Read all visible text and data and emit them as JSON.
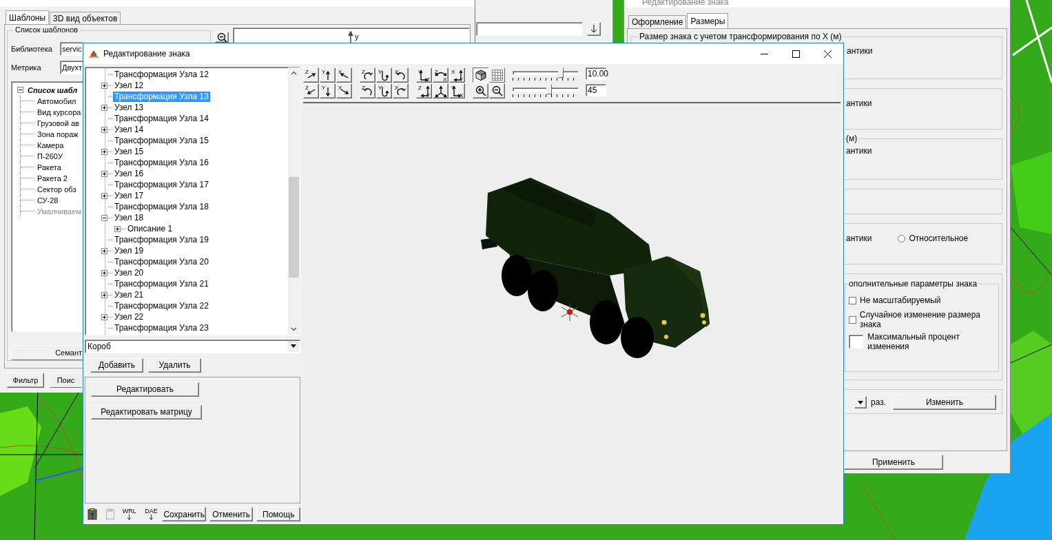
{
  "left_window": {
    "tabs": [
      {
        "label": "Шаблоны",
        "selected": true
      },
      {
        "label": "3D вид объектов",
        "selected": false
      }
    ],
    "group_title": "Список шаблонов",
    "library": {
      "label": "Библиотека",
      "value": "servic"
    },
    "metric": {
      "label": "Метрика",
      "value": "Двухт"
    },
    "templates": {
      "label": "Список шабл",
      "expanded": true,
      "children": [
        {
          "label": "Автомобил",
          "disabled": false
        },
        {
          "label": "Вид курсора",
          "disabled": false
        },
        {
          "label": "Грузовой ав",
          "disabled": false
        },
        {
          "label": "Зона пораж",
          "disabled": false
        },
        {
          "label": "Камера",
          "disabled": false
        },
        {
          "label": "П-260У",
          "disabled": false
        },
        {
          "label": "Ракета",
          "disabled": false
        },
        {
          "label": "Ракета 2",
          "disabled": false
        },
        {
          "label": "Сектор обз",
          "disabled": false
        },
        {
          "label": "СУ-28",
          "disabled": false
        },
        {
          "label": "Умалчиваем",
          "disabled": true
        }
      ]
    },
    "semantics_button": "Семант",
    "buttons": [
      "Фильтр",
      "Поис"
    ],
    "preview_axis": "y"
  },
  "right_window": {
    "title": "Редактирование знака",
    "tabs": [
      {
        "label": "Оформление",
        "selected": false
      },
      {
        "label": "Размеры",
        "selected": true
      }
    ],
    "groups": [
      {
        "kind": "text",
        "title": "Размер знака с учетом трансформирования по X (м)",
        "text": "антики"
      },
      {
        "kind": "text",
        "text": "антики"
      },
      {
        "kind": "text",
        "title_tail": "(м)",
        "text": "антики"
      },
      {
        "kind": "empty"
      },
      {
        "kind": "radio",
        "text": "антики",
        "radio": {
          "label": "Относительное",
          "selected": false
        }
      },
      {
        "kind": "options",
        "title_tail": "ополнительные параметры знака",
        "options": [
          {
            "label": "Не масштабируемый",
            "checked": false
          },
          {
            "label": "Случайное изменение размера знака",
            "checked": false
          }
        ],
        "percent_label": "Максимальный процент изменения"
      },
      {
        "kind": "scale",
        "unit": "раз.",
        "button": "Изменить"
      }
    ],
    "apply_button": "Применить"
  },
  "editor": {
    "title": "Редактирование знака",
    "tree": [
      {
        "label": "Трансформация Узла 12",
        "selected": false
      },
      {
        "label": "Узел 12",
        "expanded": false,
        "selected": false
      },
      {
        "label": "Трансформация Узла 13",
        "selected": true
      },
      {
        "label": "Узел 13",
        "expanded": false,
        "selected": false
      },
      {
        "label": "Трансформация Узла 14",
        "selected": false
      },
      {
        "label": "Узел 14",
        "expanded": false,
        "selected": false
      },
      {
        "label": "Трансформация Узла 15",
        "selected": false
      },
      {
        "label": "Узел 15",
        "expanded": false,
        "selected": false
      },
      {
        "label": "Трансформация Узла 16",
        "selected": false
      },
      {
        "label": "Узел 16",
        "expanded": false,
        "selected": false
      },
      {
        "label": "Трансформация Узла 17",
        "selected": false
      },
      {
        "label": "Узел 17",
        "expanded": false,
        "selected": false
      },
      {
        "label": "Трансформация Узла 18",
        "selected": false
      },
      {
        "label": "Узел 18",
        "expanded": true,
        "selected": false,
        "children": [
          {
            "label": "Описание 1",
            "expanded": false,
            "selected": false
          }
        ]
      },
      {
        "label": "Трансформация Узла 19",
        "selected": false
      },
      {
        "label": "Узел 19",
        "expanded": false,
        "selected": false
      },
      {
        "label": "Трансформация Узла 20",
        "selected": false
      },
      {
        "label": "Узел 20",
        "expanded": false,
        "selected": false
      },
      {
        "label": "Трансформация Узла 21",
        "selected": false
      },
      {
        "label": "Узел 21",
        "expanded": false,
        "selected": false
      },
      {
        "label": "Трансформация Узла 22",
        "selected": false
      },
      {
        "label": "Узел 22",
        "expanded": false,
        "selected": false
      },
      {
        "label": "Трансформация Узла 23",
        "selected": false
      }
    ],
    "element_type": "Короб",
    "add_button": "Добавить",
    "delete_button": "Удалить",
    "edit_button": "Редактировать",
    "matrix_button": "Редактировать матрицу",
    "export_formats": [
      "WRL",
      "DAE"
    ],
    "footer_buttons": [
      "Сохранить",
      "Отменить",
      "Помощь"
    ],
    "tool_groups": [
      [
        {
          "kind": "move-ne",
          "labels": [
            "Z"
          ]
        },
        {
          "kind": "move-n",
          "labels": [
            "Y"
          ]
        },
        {
          "kind": "move-nw",
          "labels": [
            "X"
          ]
        },
        {
          "kind": "move-sw",
          "labels": [
            "Z"
          ]
        },
        {
          "kind": "move-s",
          "labels": [
            "Y"
          ]
        },
        {
          "kind": "move-se",
          "labels": [
            "X"
          ]
        }
      ],
      [
        {
          "kind": "rotate-ccw",
          "labels": [
            "Z"
          ]
        },
        {
          "kind": "rotate-down",
          "labels": [
            "Y"
          ]
        },
        {
          "kind": "rotate-cw",
          "labels": [
            "X"
          ]
        },
        {
          "kind": "rotate-cw",
          "labels": [
            "Z"
          ]
        },
        {
          "kind": "rotate-down",
          "labels": [
            "Y"
          ]
        },
        {
          "kind": "rotate-ccw",
          "labels": [
            "X"
          ]
        }
      ],
      [
        {
          "kind": "axes",
          "labels": [
            "Y",
            "Z"
          ]
        },
        {
          "kind": "arc",
          "labels": [
            "Z",
            "X"
          ]
        },
        {
          "kind": "axes-flip",
          "labels": [
            "X",
            "Y"
          ]
        },
        {
          "kind": "axes-flip",
          "labels": [
            "Z",
            "Y"
          ]
        },
        {
          "kind": "tripod"
        },
        {
          "kind": "axes",
          "labels": [
            "Y",
            "X"
          ]
        }
      ]
    ],
    "view_mode": {
      "solid": true,
      "grid": false
    },
    "sliders": [
      {
        "level": 0.73,
        "value": "10.00"
      },
      {
        "level": 0.55,
        "value": "45"
      }
    ]
  }
}
